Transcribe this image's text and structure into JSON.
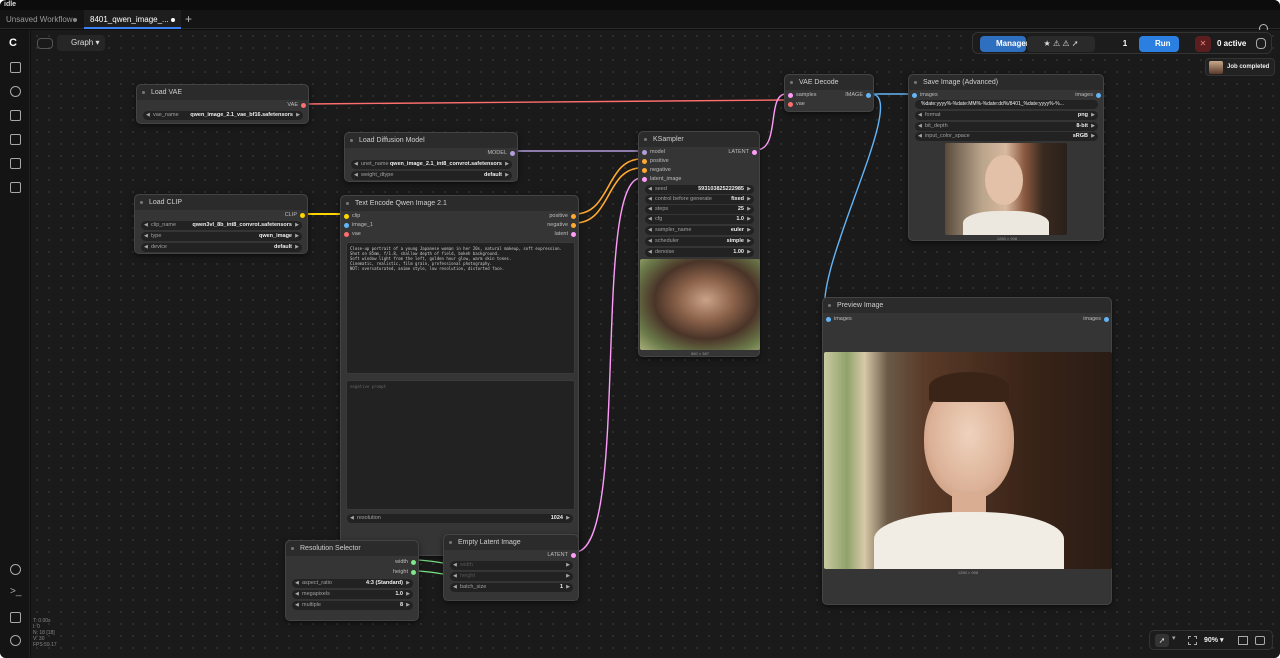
{
  "titlebar": {
    "text": "idle"
  },
  "tabs": [
    {
      "label": "Unsaved Workflow"
    },
    {
      "label": "8401_qwen_image_..."
    }
  ],
  "canvas_header": {
    "graph_label": "Graph"
  },
  "toolbar": {
    "manager_label": "Manager",
    "queue_count": "1",
    "run_label": "Run",
    "active_label": "0 active",
    "job_completed": "Job completed"
  },
  "bottom_right": {
    "zoom": "90%"
  },
  "stats": {
    "lines": [
      "T: 0.00s",
      "I: 0",
      "N: 18 [18]",
      "V: 30",
      "FPS:59.17"
    ]
  },
  "nodes": {
    "load_vae": {
      "title": "Load VAE",
      "out": "VAE",
      "w_name": "vae_name",
      "w_val": "qwen_image_2.1_vae_bf16.safetensors"
    },
    "load_diffusion": {
      "title": "Load Diffusion Model",
      "out": "MODEL",
      "w1_name": "unet_name",
      "w1_val": "qwen_image_2.1_int8_convrot.safetensors",
      "w2_name": "weight_dtype",
      "w2_val": "default"
    },
    "load_clip": {
      "title": "Load CLIP",
      "out": "CLIP",
      "w1_name": "clip_name",
      "w1_val": "qwen3vl_8b_int8_convrot.safetensors",
      "w2_name": "type",
      "w2_val": "qwen_image",
      "w3_name": "device",
      "w3_val": "default"
    },
    "text_encode": {
      "title": "Text Encode Qwen Image 2.1",
      "in1": "clip",
      "in2": "image_1",
      "in3": "vae",
      "out1": "positive",
      "out2": "negative",
      "out3": "latent",
      "prompt": "Close-up portrait of a young Japanese woman in her 20s, natural makeup, soft expression.\nShot on 85mm, f/1.8, shallow depth of field, bokeh background.\nSoft window light from the left, golden hour glow, warm skin tones.\nCinematic, realistic, film grain, professional photography.\nNOT: oversaturated, anime style, low resolution, distorted face.",
      "negative_placeholder": "negative prompt",
      "w_name": "resolution",
      "w_val": "1024"
    },
    "ksampler": {
      "title": "KSampler",
      "in1": "model",
      "in2": "positive",
      "in3": "negative",
      "in4": "latent_image",
      "out": "LATENT",
      "widgets": [
        {
          "name": "seed",
          "val": "593103825222985"
        },
        {
          "name": "control before generate",
          "val": "fixed"
        },
        {
          "name": "steps",
          "val": "25"
        },
        {
          "name": "cfg",
          "val": "1.0"
        },
        {
          "name": "sampler_name",
          "val": "euler"
        },
        {
          "name": "scheduler",
          "val": "simple"
        },
        {
          "name": "denoise",
          "val": "1.00"
        }
      ],
      "caption": "560 × 387"
    },
    "vae_decode": {
      "title": "VAE Decode",
      "in1": "samples",
      "in2": "vae",
      "out": "IMAGE"
    },
    "save_image": {
      "title": "Save Image (Advanced)",
      "in": "images",
      "out": "images",
      "filename": "%date:yyyy%-%date:MM%-%date:dd%/8401_%date:yyyy%-%...",
      "widgets": [
        {
          "name": "format",
          "val": "png"
        },
        {
          "name": "bit_depth",
          "val": "8-bit"
        },
        {
          "name": "input_color_space",
          "val": "sRGB"
        }
      ],
      "caption": "1280 × 908"
    },
    "preview_image": {
      "title": "Preview Image",
      "in": "images",
      "out": "images",
      "caption": "1280 × 908"
    },
    "resolution_selector": {
      "title": "Resolution Selector",
      "out1": "width",
      "out2": "height",
      "widgets": [
        {
          "name": "aspect_ratio",
          "val": "4:3 (Standard)"
        },
        {
          "name": "megapixels",
          "val": "1.0"
        },
        {
          "name": "multiple",
          "val": "8"
        }
      ]
    },
    "empty_latent": {
      "title": "Empty Latent Image",
      "out": "LATENT",
      "in1": "width",
      "in2": "height",
      "w_name": "batch_size",
      "w_val": "1"
    }
  },
  "colors": {
    "vae": "#ff6e6e",
    "clip": "#ffd500",
    "model": "#b39ddb",
    "conditioning": "#ffa931",
    "latent": "#ff9cf9",
    "image": "#64b5f6",
    "int": "#7ee787",
    "accent": "#3b82f6"
  },
  "icons": {
    "sidebar": [
      "comfy-logo-icon",
      "images-icon",
      "queue-icon",
      "nodes-library-icon",
      "models-icon",
      "workflows-icon",
      "templates-icon",
      "help-icon",
      "terminal-icon",
      "keyboard-icon",
      "settings-icon"
    ]
  }
}
